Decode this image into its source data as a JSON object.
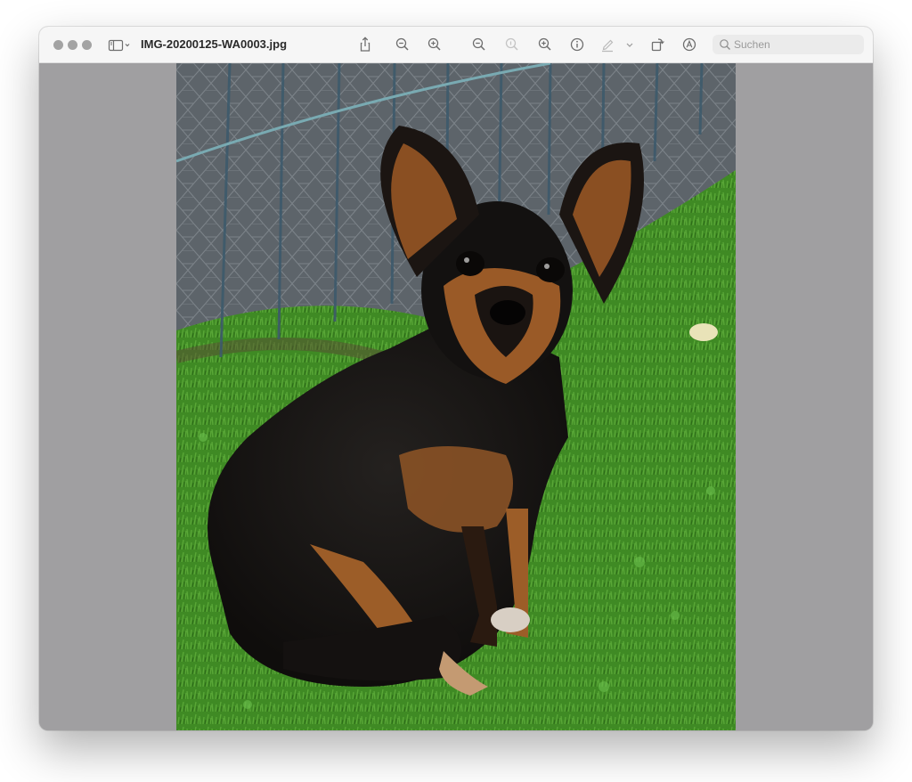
{
  "window": {
    "title": "IMG-20200125-WA0003.jpg"
  },
  "toolbar": {
    "sidebar_icon": "sidebar-toggle-icon",
    "items": [
      {
        "name": "share-icon"
      },
      {
        "name": "zoom-out-icon"
      },
      {
        "name": "zoom-in-icon"
      },
      {
        "name": "zoom-out-icon"
      },
      {
        "name": "actual-size-icon"
      },
      {
        "name": "zoom-in-icon"
      },
      {
        "name": "info-icon"
      },
      {
        "name": "highlight-pen-icon"
      },
      {
        "name": "chevron-down-icon"
      },
      {
        "name": "rotate-icon"
      },
      {
        "name": "markup-icon"
      }
    ]
  },
  "search": {
    "placeholder": "Suchen",
    "value": ""
  },
  "document": {
    "image_subject": "photo of small black and tan long-haired chihuahua sitting on grass in front of a wire fence"
  }
}
